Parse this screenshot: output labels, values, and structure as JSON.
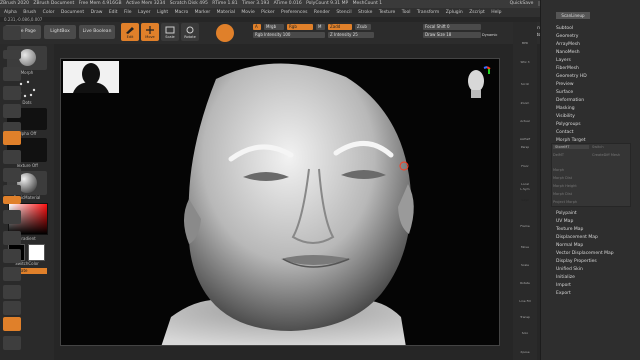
{
  "titlebar": {
    "title": "ZBrush 2020",
    "doc": "ZBrush Document",
    "free_mem": "Free Mem 4.916GB",
    "active_mem": "Active Mem 3234",
    "scratch": "Scratch Disk 495",
    "rtime": "RTime 1.81",
    "timer": "Timer 3.193",
    "atime": "ATime 0.016",
    "polycount": "PolyCount 9.31 MP",
    "meshcount": "MeshCount 1",
    "quicksave": "QuickSave",
    "seethrough": "See-through 0",
    "menus": "Menus",
    "script": "DefaultZScript"
  },
  "menubar": [
    "Alpha",
    "Brush",
    "Color",
    "Document",
    "Draw",
    "Edit",
    "File",
    "Layer",
    "Light",
    "Macro",
    "Marker",
    "Material",
    "Movie",
    "Picker",
    "Preferences",
    "Render",
    "Stencil",
    "Stroke",
    "Texture",
    "Tool",
    "Transform",
    "Zplugin",
    "Zscript",
    "Help"
  ],
  "coords": "0.231,-0.086,0.007",
  "topshelf": {
    "home": "Home Page",
    "lightbox": "LightBox",
    "boolean": "Live Boolean",
    "edit": "Edit",
    "move": "Move",
    "scale": "Scale",
    "rotate": "Rotate",
    "a": "A",
    "mrgb": "Mrgb",
    "rgb": "Rgb",
    "m": "M",
    "zadd": "Zadd",
    "zsub": "Zsub",
    "rgb_intensity": "Rgb Intensity 100",
    "z_intensity": "Z Intensity 25",
    "focal_shift": "Focal Shift 0",
    "draw_size": "Draw Size 18",
    "dynamic": "Dynamic",
    "activepoints": "ActivePoints:",
    "totalpoints": "TotalPoints:"
  },
  "leftshelf": {
    "brush": "Morph",
    "stroke": "Dots",
    "alpha": "Alpha Off",
    "texture": "Texture Off",
    "material": "BasicMaterial",
    "gradient": "Gradient",
    "switchcolor": "SwitchColor",
    "alternate": "Alternate"
  },
  "rightshelf": [
    "BPR",
    "SPix 3",
    "Scroll",
    "Zoom",
    "Actual",
    "AAHalf",
    "Persp",
    "Floor",
    "Local",
    "L.Sym",
    "Gxyz",
    "Frame",
    "Move",
    "Scale",
    "Rotate",
    "Line Fill",
    "PolyF",
    "Transp",
    "Ghost",
    "Solo",
    "Xpose",
    "Dynamic"
  ],
  "tray": {
    "button": "ScanLineup",
    "items_top": [
      "Subtool",
      "Geometry",
      "ArrayMesh",
      "NanoMesh",
      "Layers",
      "FiberMesh",
      "Geometry HD",
      "Preview",
      "Surface",
      "Deformation",
      "Masking",
      "Visibility",
      "Polygroups",
      "Contact",
      "Morph Target"
    ],
    "morph": {
      "storemt": "StoreMT",
      "switch": "Switch",
      "delmt": "DelMT",
      "creatediff": "CreateDiff Mesh",
      "morph": "Morph",
      "morph_dist": "Morph Dist",
      "morph_height": "Morph Height",
      "morph_dist2": "Morph Dist",
      "project_morph": "Project Morph"
    },
    "items_bottom": [
      "Polypaint",
      "UV Map",
      "Texture Map",
      "Displacement Map",
      "Normal Map",
      "Vector Displacement Map",
      "Display Properties",
      "Unified Skin",
      "Initialize",
      "Import",
      "Export"
    ]
  },
  "colors": {
    "accent": "#e0802a",
    "active_color": "#ff3b1f"
  }
}
